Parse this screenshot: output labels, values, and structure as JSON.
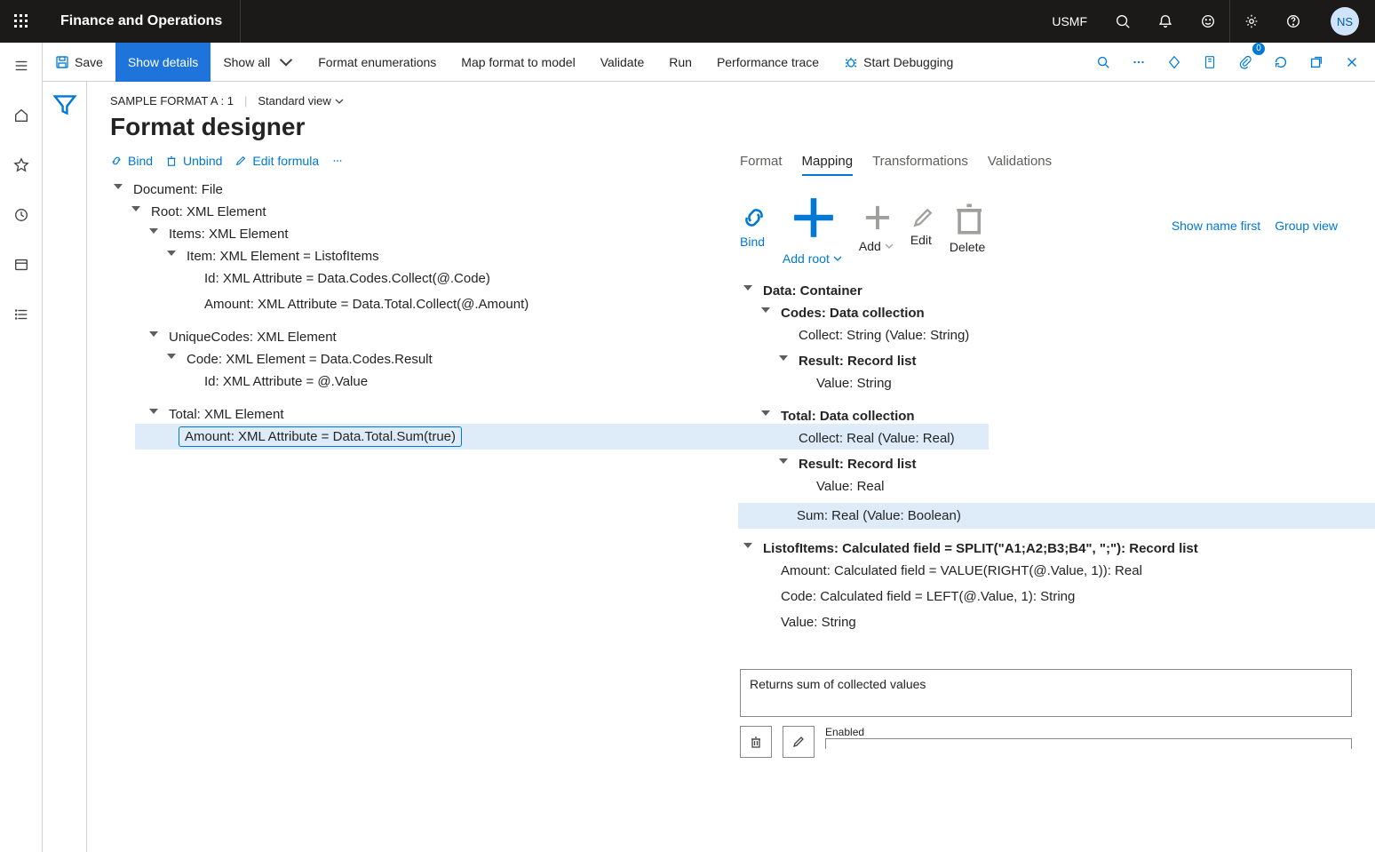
{
  "topbar": {
    "app_title": "Finance and Operations",
    "org": "USMF",
    "avatar_initials": "NS"
  },
  "actionbar": {
    "save": "Save",
    "show_details": "Show details",
    "show_all": "Show all",
    "format_enum": "Format enumerations",
    "map_format": "Map format to model",
    "validate": "Validate",
    "run": "Run",
    "perf_trace": "Performance trace",
    "start_debug": "Start Debugging",
    "badge": "0"
  },
  "breadcrumb": {
    "path": "SAMPLE FORMAT A : 1",
    "view": "Standard view"
  },
  "page_title": "Format designer",
  "left_toolbar": {
    "bind": "Bind",
    "unbind": "Unbind",
    "edit_formula": "Edit formula"
  },
  "tabs": {
    "format": "Format",
    "mapping": "Mapping",
    "transformations": "Transformations",
    "validations": "Validations"
  },
  "mapping_toolbar": {
    "bind": "Bind",
    "add_root": "Add root",
    "add": "Add",
    "edit": "Edit",
    "delete": "Delete",
    "show_name_first": "Show name first",
    "group_view": "Group view"
  },
  "left_tree": {
    "n0": "Document: File",
    "n1": "Root: XML Element",
    "n2": "Items: XML Element",
    "n3": "Item: XML Element = ListofItems",
    "n4": "Id: XML Attribute = Data.Codes.Collect(@.Code)",
    "n5": "Amount: XML Attribute = Data.Total.Collect(@.Amount)",
    "n6": "UniqueCodes: XML Element",
    "n7": "Code: XML Element = Data.Codes.Result",
    "n8": "Id: XML Attribute = @.Value",
    "n9": "Total: XML Element",
    "n10": "Amount: XML Attribute = Data.Total.Sum(true)"
  },
  "right_tree": {
    "n0": "Data: Container",
    "n1": "Codes: Data collection",
    "n2": "Collect: String (Value: String)",
    "n3": "Result: Record list",
    "n4": "Value: String",
    "n5": "Total: Data collection",
    "n6": "Collect: Real (Value: Real)",
    "n7": "Result: Record list",
    "n8": "Value: Real",
    "n9": "Sum: Real (Value: Boolean)",
    "n10": "ListofItems: Calculated field = SPLIT(\"A1;A2;B3;B4\", \";\"): Record list",
    "n11": "Amount: Calculated field = VALUE(RIGHT(@.Value, 1)): Real",
    "n12": "Code: Calculated field = LEFT(@.Value, 1): String",
    "n13": "Value: String"
  },
  "description": "Returns sum of collected values",
  "enabled_label": "Enabled"
}
